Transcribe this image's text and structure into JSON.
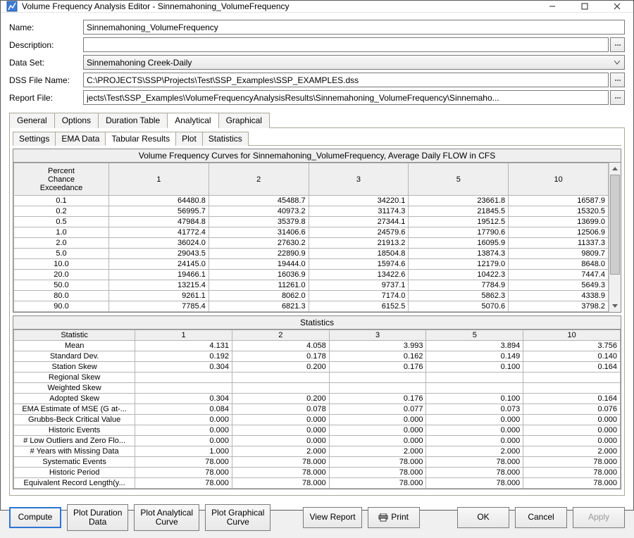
{
  "titlebar": {
    "title": "Volume Frequency Analysis Editor - Sinnemahoning_VolumeFrequency"
  },
  "form": {
    "name_label": "Name:",
    "name_value": "Sinnemahoning_VolumeFrequency",
    "desc_label": "Description:",
    "desc_value": "",
    "dataset_label": "Data Set:",
    "dataset_value": "Sinnemahoning Creek-Daily",
    "dss_label": "DSS File Name:",
    "dss_value": "C:\\PROJECTS\\SSP\\Projects\\Test\\SSP_Examples\\SSP_EXAMPLES.dss",
    "report_label": "Report File:",
    "report_value": "jects\\Test\\SSP_Examples\\VolumeFrequencyAnalysisResults\\Sinnemahoning_VolumeFrequency\\Sinnemaho..."
  },
  "tabs": {
    "main": [
      "General",
      "Options",
      "Duration Table",
      "Analytical",
      "Graphical"
    ],
    "main_active": 3,
    "sub": [
      "Settings",
      "EMA Data",
      "Tabular Results",
      "Plot",
      "Statistics"
    ],
    "sub_active": 2
  },
  "freq_table": {
    "title": "Volume Frequency Curves for Sinnemahoning_VolumeFrequency, Average Daily FLOW in CFS",
    "col0": "Percent\nChance\nExceedance",
    "cols": [
      "1",
      "2",
      "3",
      "5",
      "10"
    ],
    "rows": [
      {
        "p": "0.1",
        "v": [
          "64480.8",
          "45488.7",
          "34220.1",
          "23661.8",
          "16587.9"
        ]
      },
      {
        "p": "0.2",
        "v": [
          "56995.7",
          "40973.2",
          "31174.3",
          "21845.5",
          "15320.5"
        ]
      },
      {
        "p": "0.5",
        "v": [
          "47984.8",
          "35379.8",
          "27344.1",
          "19512.5",
          "13699.0"
        ]
      },
      {
        "p": "1.0",
        "v": [
          "41772.4",
          "31406.6",
          "24579.6",
          "17790.6",
          "12506.9"
        ]
      },
      {
        "p": "2.0",
        "v": [
          "36024.0",
          "27630.2",
          "21913.2",
          "16095.9",
          "11337.3"
        ]
      },
      {
        "p": "5.0",
        "v": [
          "29043.5",
          "22890.9",
          "18504.8",
          "13874.3",
          "9809.7"
        ]
      },
      {
        "p": "10.0",
        "v": [
          "24145.0",
          "19444.0",
          "15974.6",
          "12179.0",
          "8648.0"
        ]
      },
      {
        "p": "20.0",
        "v": [
          "19466.1",
          "16036.9",
          "13422.6",
          "10422.3",
          "7447.4"
        ]
      },
      {
        "p": "50.0",
        "v": [
          "13215.4",
          "11261.0",
          "9737.1",
          "7784.9",
          "5649.3"
        ]
      },
      {
        "p": "80.0",
        "v": [
          "9261.1",
          "8062.0",
          "7174.0",
          "5862.3",
          "4338.9"
        ]
      },
      {
        "p": "90.0",
        "v": [
          "7785.4",
          "6821.3",
          "6152.5",
          "5070.6",
          "3798.2"
        ]
      }
    ]
  },
  "stats_table": {
    "title": "Statistics",
    "col0": "Statistic",
    "cols": [
      "1",
      "2",
      "3",
      "5",
      "10"
    ],
    "rows": [
      {
        "s": "Mean",
        "v": [
          "4.131",
          "4.058",
          "3.993",
          "3.894",
          "3.756"
        ]
      },
      {
        "s": "Standard Dev.",
        "v": [
          "0.192",
          "0.178",
          "0.162",
          "0.149",
          "0.140"
        ]
      },
      {
        "s": "Station Skew",
        "v": [
          "0.304",
          "0.200",
          "0.176",
          "0.100",
          "0.164"
        ]
      },
      {
        "s": "Regional Skew",
        "v": [
          "",
          "",
          "",
          "",
          ""
        ]
      },
      {
        "s": "Weighted Skew",
        "v": [
          "",
          "",
          "",
          "",
          ""
        ]
      },
      {
        "s": "Adopted Skew",
        "v": [
          "0.304",
          "0.200",
          "0.176",
          "0.100",
          "0.164"
        ]
      },
      {
        "s": "EMA Estimate of MSE (G at-...",
        "v": [
          "0.084",
          "0.078",
          "0.077",
          "0.073",
          "0.076"
        ]
      },
      {
        "s": "Grubbs-Beck Critical Value",
        "v": [
          "0.000",
          "0.000",
          "0.000",
          "0.000",
          "0.000"
        ]
      },
      {
        "s": "Historic Events",
        "v": [
          "0.000",
          "0.000",
          "0.000",
          "0.000",
          "0.000"
        ]
      },
      {
        "s": "# Low Outliers and Zero Flo...",
        "v": [
          "0.000",
          "0.000",
          "0.000",
          "0.000",
          "0.000"
        ]
      },
      {
        "s": "# Years with Missing Data",
        "v": [
          "1.000",
          "2.000",
          "2.000",
          "2.000",
          "2.000"
        ]
      },
      {
        "s": "Systematic Events",
        "v": [
          "78.000",
          "78.000",
          "78.000",
          "78.000",
          "78.000"
        ]
      },
      {
        "s": "Historic Period",
        "v": [
          "78.000",
          "78.000",
          "78.000",
          "78.000",
          "78.000"
        ]
      },
      {
        "s": "Equivalent Record Length(y...",
        "v": [
          "78.000",
          "78.000",
          "78.000",
          "78.000",
          "78.000"
        ]
      }
    ]
  },
  "buttons": {
    "compute": "Compute",
    "plot_dur": "Plot Duration\nData",
    "plot_ana": "Plot Analytical\nCurve",
    "plot_gra": "Plot Graphical\nCurve",
    "view_report": "View Report",
    "print": "Print",
    "ok": "OK",
    "cancel": "Cancel",
    "apply": "Apply"
  }
}
